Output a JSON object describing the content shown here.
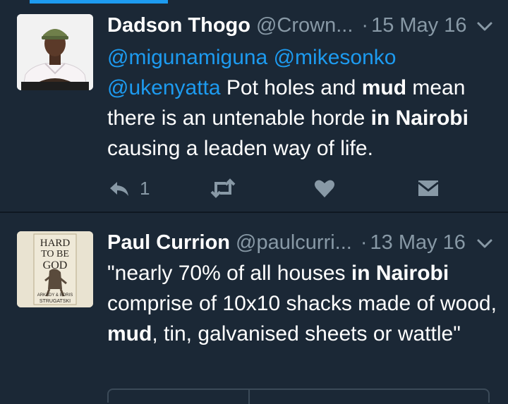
{
  "colors": {
    "background": "#1b2836",
    "mention": "#1d9bf0",
    "muted": "#8899a6",
    "text": "#ffffff"
  },
  "tweets": [
    {
      "name": "Dadson Thogo",
      "handle": "@Crown...",
      "separator": "·",
      "date": "15 May 16",
      "avatar_icon": "profile-photo",
      "body": {
        "m1": "@migunamiguna",
        "m2": "@mikesonko",
        "m3": "@ukenyatta",
        "t1": " Pot holes and ",
        "b1": "mud",
        "t2": " mean there is an untenable horde ",
        "b2": "in Nairobi",
        "t3": " causing a leaden way of life."
      },
      "actions": {
        "reply_count": "1",
        "reply_icon": "reply-icon",
        "retweet_icon": "retweet-icon",
        "like_icon": "heart-icon",
        "dm_icon": "envelope-icon"
      }
    },
    {
      "name": "Paul Currion",
      "handle": "@paulcurri...",
      "separator": "·",
      "date": "13 May 16",
      "avatar_icon": "book-cover",
      "avatar_text": {
        "line1": "HARD",
        "line2": "TO BE",
        "line3": "GOD",
        "line4": "ARKADY & BORIS",
        "line5": "STRUGATSKI"
      },
      "body": {
        "t1": "\"nearly 70% of all houses ",
        "b1": "in Nairobi",
        "t2": " comprise of 10x10 shacks made of wood, ",
        "b2": "mud",
        "t3": ", tin, galvanised sheets or wattle\""
      }
    }
  ]
}
